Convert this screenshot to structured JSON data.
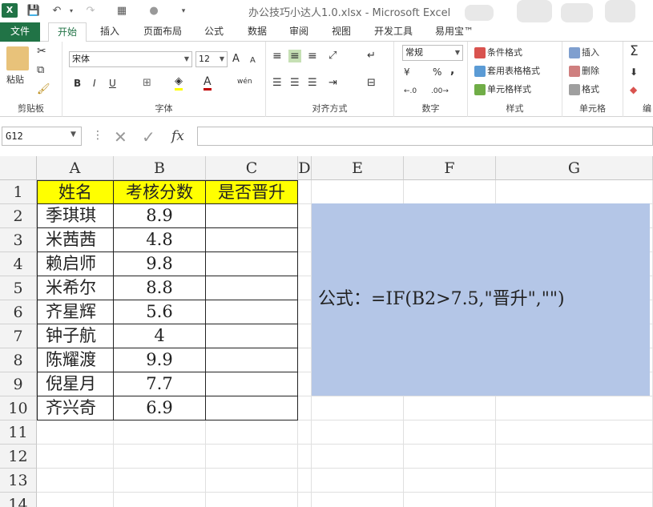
{
  "window": {
    "title": "办公技巧小达人1.0.xlsx - Microsoft Excel",
    "app_icon": "X"
  },
  "tabs": [
    "文件",
    "开始",
    "插入",
    "页面布局",
    "公式",
    "数据",
    "审阅",
    "视图",
    "开发工具",
    "易用宝™"
  ],
  "ribbon": {
    "clipboard": {
      "label": "剪贴板",
      "paste": "粘贴"
    },
    "font": {
      "label": "字体",
      "name": "宋体",
      "size": "12",
      "bold": "B",
      "italic": "I",
      "underline": "U",
      "grow": "A",
      "shrink": "A",
      "fontcolor": "A",
      "wen": "wén"
    },
    "align": {
      "label": "对齐方式"
    },
    "number": {
      "label": "数字",
      "format": "常规",
      "percent": "%",
      "comma": ","
    },
    "styles": {
      "label": "样式",
      "cond": "条件格式",
      "table": "套用表格格式",
      "cell": "单元格样式"
    },
    "cells": {
      "label": "单元格",
      "insert": "插入",
      "delete": "删除",
      "format": "格式"
    },
    "edit": {
      "label": "编"
    }
  },
  "formula_bar": {
    "name_box": "G12",
    "fx": "fx",
    "value": ""
  },
  "columns": [
    "A",
    "B",
    "C",
    "D",
    "E",
    "F",
    "G"
  ],
  "rows": [
    "1",
    "2",
    "3",
    "4",
    "5",
    "6",
    "7",
    "8",
    "9",
    "10",
    "11",
    "12",
    "13",
    "14"
  ],
  "table": {
    "headers": [
      "姓名",
      "考核分数",
      "是否晋升"
    ],
    "data": [
      [
        "季琪琪",
        "8.9",
        ""
      ],
      [
        "米茜茜",
        "4.8",
        ""
      ],
      [
        "赖启师",
        "9.8",
        ""
      ],
      [
        "米希尔",
        "8.8",
        ""
      ],
      [
        "齐星辉",
        "5.6",
        ""
      ],
      [
        "钟子航",
        "4",
        ""
      ],
      [
        "陈耀渡",
        "9.9",
        ""
      ],
      [
        "倪星月",
        "7.7",
        ""
      ],
      [
        "齐兴奇",
        "6.9",
        ""
      ]
    ]
  },
  "formula_note": "公式：=IF(B2>7.5,\"晋升\",\"\")",
  "colors": {
    "excel_green": "#217346",
    "header_yellow": "#ffff00",
    "note_blue": "#b4c6e7"
  }
}
